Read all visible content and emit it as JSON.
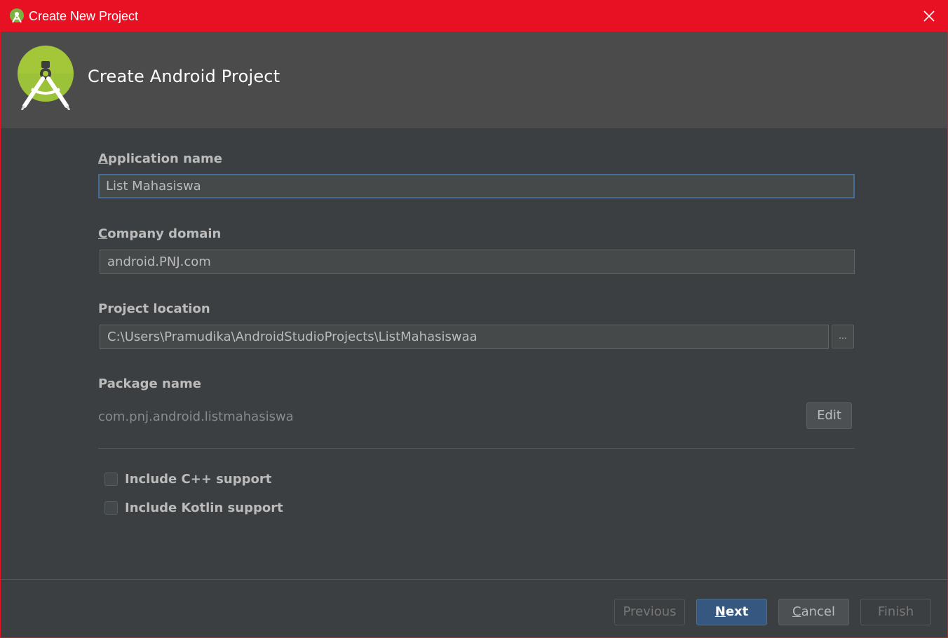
{
  "window": {
    "title": "Create New Project"
  },
  "header": {
    "title": "Create Android Project"
  },
  "form": {
    "app_name": {
      "label_underline": "A",
      "label_rest": "pplication name",
      "value": "List Mahasiswa"
    },
    "company_domain": {
      "label_underline": "C",
      "label_rest": "ompany domain",
      "value": "android.PNJ.com"
    },
    "project_location": {
      "label": "Project location",
      "value": "C:\\Users\\Pramudika\\AndroidStudioProjects\\ListMahasiswaa",
      "browse_label": "..."
    },
    "package_name": {
      "label": "Package name",
      "value": "com.pnj.android.listmahasiswa",
      "edit_label": "Edit"
    },
    "options": [
      {
        "label": "Include C++ support",
        "checked": false
      },
      {
        "label": "Include Kotlin support",
        "checked": false
      }
    ]
  },
  "footer": {
    "previous_label": "Previous",
    "next_underline": "N",
    "next_rest": "ext",
    "cancel_underline": "C",
    "cancel_rest": "ancel",
    "finish_label": "Finish"
  },
  "icons": {
    "app": "android-studio-icon",
    "close": "close-icon",
    "logo": "android-studio-logo"
  },
  "colors": {
    "titlebar": "#e81123",
    "header_bg": "#4b4b4b",
    "body_bg": "#3c3f41",
    "accent_focus": "#466d94",
    "primary_button": "#365880",
    "logo_green": "#a4c639"
  }
}
